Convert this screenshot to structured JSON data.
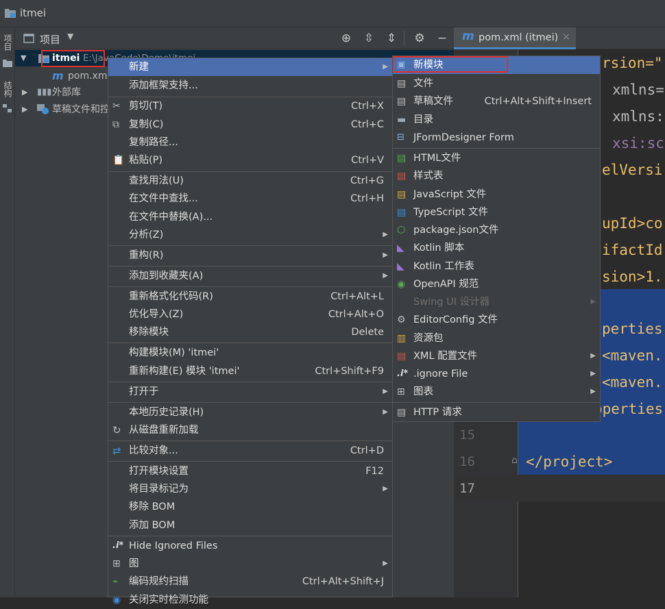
{
  "titlebar": {
    "title": "itmei"
  },
  "left_strip": {
    "tab1": "项目",
    "tab2": "结构"
  },
  "panel_header": {
    "title": "项目"
  },
  "editor_tab": {
    "label": "pom.xml (itmei)"
  },
  "tree": {
    "root_name": "itmei",
    "root_path": "E:\\JavaCode\\Demo\\itmei",
    "pom_item": "pom.xml",
    "external_libs": "外部库",
    "scratches": "草稿文件和控制台"
  },
  "code": {
    "lines": [
      "rsion=\"",
      "xmlns=",
      "xmlns:",
      "xsi:sc",
      "elVersi",
      "",
      "upId>co",
      "ifactId",
      "sion>1.",
      "",
      "perties",
      "<maven.",
      "<maven.",
      "operties",
      "",
      "</project>",
      ""
    ],
    "line_numbers": [
      "15",
      "16",
      "17"
    ]
  },
  "context_menu": {
    "items": [
      {
        "label": "新建",
        "shortcut": "",
        "submenu": true
      },
      {
        "label": "添加框架支持...",
        "shortcut": ""
      },
      {
        "label": "剪切(T)",
        "shortcut": "Ctrl+X"
      },
      {
        "label": "复制(C)",
        "shortcut": "Ctrl+C"
      },
      {
        "label": "复制路径...",
        "shortcut": ""
      },
      {
        "label": "粘贴(P)",
        "shortcut": "Ctrl+V"
      },
      {
        "label": "查找用法(U)",
        "shortcut": "Ctrl+G"
      },
      {
        "label": "在文件中查找...",
        "shortcut": "Ctrl+H"
      },
      {
        "label": "在文件中替换(A)...",
        "shortcut": ""
      },
      {
        "label": "分析(Z)",
        "shortcut": "",
        "submenu": true
      },
      {
        "label": "重构(R)",
        "shortcut": "",
        "submenu": true
      },
      {
        "label": "添加到收藏夹(A)",
        "shortcut": "",
        "submenu": true
      },
      {
        "label": "重新格式化代码(R)",
        "shortcut": "Ctrl+Alt+L"
      },
      {
        "label": "优化导入(Z)",
        "shortcut": "Ctrl+Alt+O"
      },
      {
        "label": "移除模块",
        "shortcut": "Delete"
      },
      {
        "label": "构建模块(M) 'itmei'",
        "shortcut": ""
      },
      {
        "label": "重新构建(E) 模块 'itmei'",
        "shortcut": "Ctrl+Shift+F9"
      },
      {
        "label": "打开于",
        "shortcut": "",
        "submenu": true
      },
      {
        "label": "本地历史记录(H)",
        "shortcut": "",
        "submenu": true
      },
      {
        "label": "从磁盘重新加载",
        "shortcut": ""
      },
      {
        "label": "比较对象...",
        "shortcut": "Ctrl+D"
      },
      {
        "label": "打开模块设置",
        "shortcut": "F12"
      },
      {
        "label": "将目录标记为",
        "shortcut": "",
        "submenu": true
      },
      {
        "label": "移除 BOM",
        "shortcut": ""
      },
      {
        "label": "添加 BOM",
        "shortcut": ""
      },
      {
        "label": "Hide Ignored Files",
        "shortcut": ""
      },
      {
        "label": "图",
        "shortcut": "",
        "submenu": true
      },
      {
        "label": "编码规约扫描",
        "shortcut": "Ctrl+Alt+Shift+J"
      },
      {
        "label": "关闭实时检测功能",
        "shortcut": ""
      }
    ]
  },
  "submenu": {
    "items": [
      {
        "label": "新模块",
        "shortcut": ""
      },
      {
        "label": "文件",
        "shortcut": ""
      },
      {
        "label": "草稿文件",
        "shortcut": "Ctrl+Alt+Shift+Insert"
      },
      {
        "label": "目录",
        "shortcut": ""
      },
      {
        "label": "JFormDesigner Form",
        "shortcut": ""
      },
      {
        "label": "HTML文件",
        "shortcut": ""
      },
      {
        "label": "样式表",
        "shortcut": ""
      },
      {
        "label": "JavaScript 文件",
        "shortcut": ""
      },
      {
        "label": "TypeScript 文件",
        "shortcut": ""
      },
      {
        "label": "package.json文件",
        "shortcut": ""
      },
      {
        "label": "Kotlin 脚本",
        "shortcut": ""
      },
      {
        "label": "Kotlin 工作表",
        "shortcut": ""
      },
      {
        "label": "OpenAPI 规范",
        "shortcut": ""
      },
      {
        "label": "Swing UI 设计器",
        "shortcut": "",
        "submenu": true
      },
      {
        "label": "EditorConfig 文件",
        "shortcut": ""
      },
      {
        "label": "资源包",
        "shortcut": ""
      },
      {
        "label": "XML 配置文件",
        "shortcut": "",
        "submenu": true
      },
      {
        "label": ".ignore File",
        "shortcut": "",
        "submenu": true
      },
      {
        "label": "图表",
        "shortcut": "",
        "submenu": true
      },
      {
        "label": "HTTP 请求",
        "shortcut": ""
      }
    ]
  },
  "colors": {
    "selection": "#4b6eaf",
    "highlight_box": "#e0302f",
    "editor_selection": "#214283"
  }
}
